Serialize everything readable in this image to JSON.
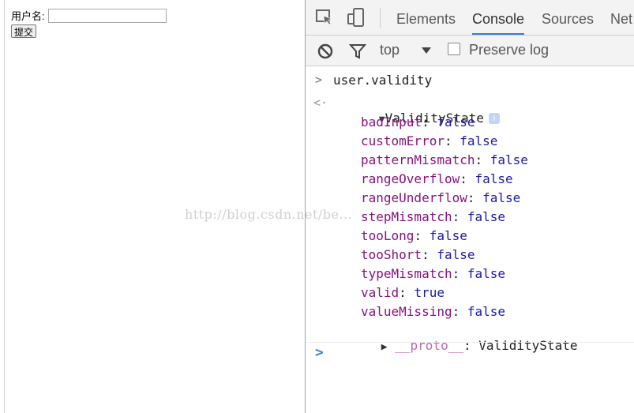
{
  "page": {
    "username_label": "用户名:",
    "username_value": "",
    "submit_label": "提交"
  },
  "devtools": {
    "tabs": [
      "Elements",
      "Console",
      "Sources",
      "Net"
    ],
    "active_tab": "Console",
    "toolbar": {
      "context": "top",
      "preserve_log_label": "Preserve log",
      "preserve_log_checked": false
    },
    "console": {
      "input_expression": "user.validity",
      "result_type": "ValidityState",
      "properties": [
        {
          "key": "badInput",
          "value": "false"
        },
        {
          "key": "customError",
          "value": "false"
        },
        {
          "key": "patternMismatch",
          "value": "false"
        },
        {
          "key": "rangeOverflow",
          "value": "false"
        },
        {
          "key": "rangeUnderflow",
          "value": "false"
        },
        {
          "key": "stepMismatch",
          "value": "false"
        },
        {
          "key": "tooLong",
          "value": "false"
        },
        {
          "key": "tooShort",
          "value": "false"
        },
        {
          "key": "typeMismatch",
          "value": "false"
        },
        {
          "key": "valid",
          "value": "true"
        },
        {
          "key": "valueMissing",
          "value": "false"
        }
      ],
      "proto_key": "__proto__",
      "proto_value": "ValidityState"
    }
  },
  "watermark": "http://blog.csdn.net/be...",
  "colors": {
    "prop_key": "#881280",
    "prop_value": "#1a1aa6",
    "active_tab_underline": "#3879d9",
    "prompt_blue": "#3b7de0"
  }
}
